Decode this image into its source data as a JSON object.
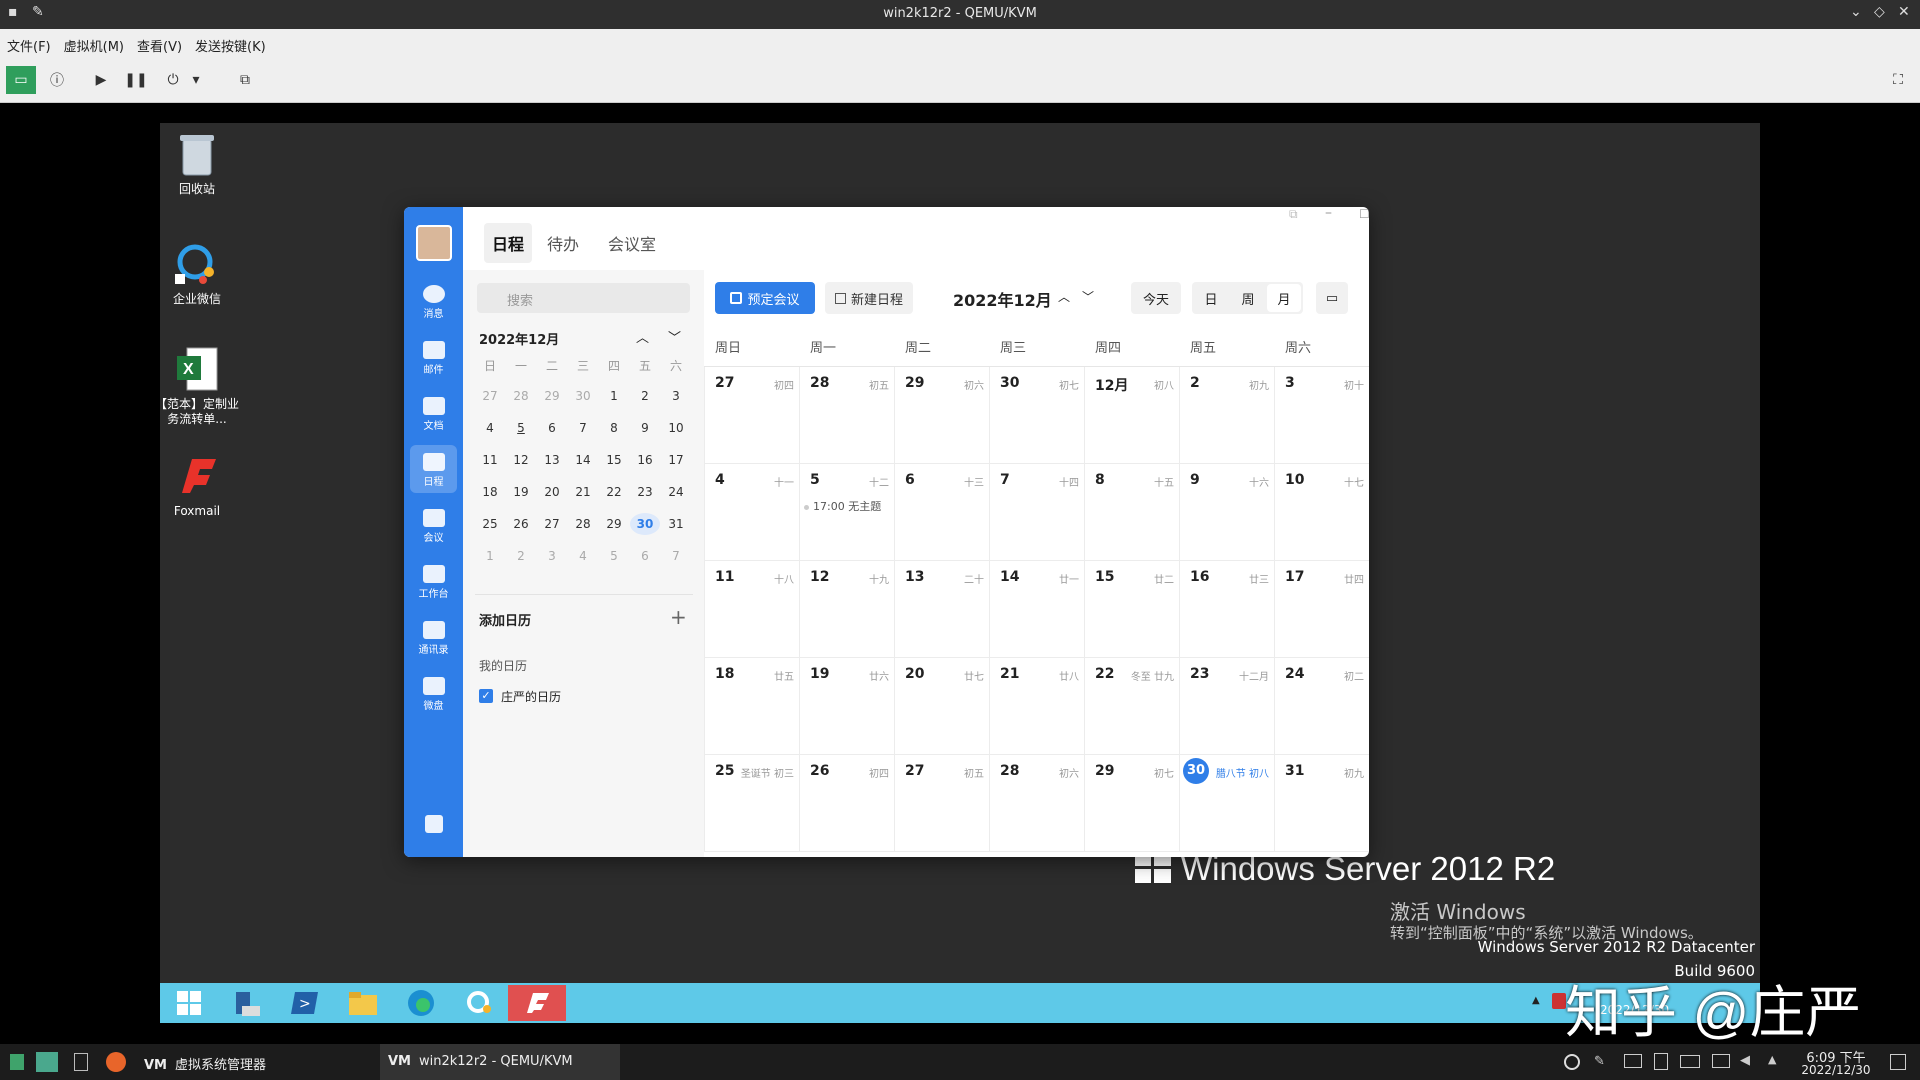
{
  "host_window": {
    "title": "win2k12r2 - QEMU/KVM",
    "menu": [
      "文件(F)",
      "虚拟机(M)",
      "查看(V)",
      "发送按键(K)"
    ]
  },
  "desktop": {
    "icons": [
      {
        "label": "回收站",
        "icon": "recycle-bin-icon"
      },
      {
        "label": "企业微信",
        "icon": "wecom-icon"
      },
      {
        "label": "【范本】定制业务流转单...",
        "icon": "excel-file-icon"
      },
      {
        "label": "Foxmail",
        "icon": "foxmail-icon"
      }
    ],
    "watermark": "Windows Server 2012 R2",
    "activate_title": "激活 Windows",
    "activate_hint": "转到“控制面板”中的“系统”以激活 Windows。",
    "edition": "Windows Server 2012 R2 Datacenter",
    "build": "Build 9600",
    "tray_date": "2022/12/30",
    "overlay": "知乎 @庄严"
  },
  "app": {
    "rail_items": [
      {
        "label": "消息",
        "icon": "message-icon"
      },
      {
        "label": "邮件",
        "icon": "mail-icon"
      },
      {
        "label": "文档",
        "icon": "document-icon"
      },
      {
        "label": "日程",
        "icon": "calendar-icon"
      },
      {
        "label": "会议",
        "icon": "meeting-icon"
      },
      {
        "label": "工作台",
        "icon": "workbench-icon"
      },
      {
        "label": "通讯录",
        "icon": "contacts-icon"
      },
      {
        "label": "微盘",
        "icon": "drive-icon"
      }
    ],
    "tabs": [
      "日程",
      "待办",
      "会议室"
    ],
    "search_placeholder": "搜索",
    "mini_title": "2022年12月",
    "mini_weekdays": [
      "日",
      "一",
      "二",
      "三",
      "四",
      "五",
      "六"
    ],
    "mini_days": [
      "27",
      "28",
      "29",
      "30",
      "1",
      "2",
      "3",
      "4",
      "5",
      "6",
      "7",
      "8",
      "9",
      "10",
      "11",
      "12",
      "13",
      "14",
      "15",
      "16",
      "17",
      "18",
      "19",
      "20",
      "21",
      "22",
      "23",
      "24",
      "25",
      "26",
      "27",
      "28",
      "29",
      "30",
      "31",
      "1",
      "2",
      "3",
      "4",
      "5",
      "6",
      "7"
    ],
    "add_calendar": "添加日历",
    "my_calendars": "我的日历",
    "calendar_name": "庄严的日历",
    "btn_book": "预定会议",
    "btn_new": "新建日程",
    "month_title": "2022年12月",
    "btn_today": "今天",
    "views": [
      "日",
      "周",
      "月"
    ],
    "week_headers": [
      "周日",
      "周一",
      "周二",
      "周三",
      "周四",
      "周五",
      "周六"
    ],
    "cells": [
      {
        "d": "27",
        "l": "初四"
      },
      {
        "d": "28",
        "l": "初五"
      },
      {
        "d": "29",
        "l": "初六"
      },
      {
        "d": "30",
        "l": "初七"
      },
      {
        "d": "12月",
        "l": "初八"
      },
      {
        "d": "2",
        "l": "初九"
      },
      {
        "d": "3",
        "l": "初十"
      },
      {
        "d": "4",
        "l": "十一"
      },
      {
        "d": "5",
        "l": "十二",
        "e": "17:00 无主题"
      },
      {
        "d": "6",
        "l": "十三"
      },
      {
        "d": "7",
        "l": "十四"
      },
      {
        "d": "8",
        "l": "十五"
      },
      {
        "d": "9",
        "l": "十六"
      },
      {
        "d": "10",
        "l": "十七"
      },
      {
        "d": "11",
        "l": "十八"
      },
      {
        "d": "12",
        "l": "十九"
      },
      {
        "d": "13",
        "l": "二十"
      },
      {
        "d": "14",
        "l": "廿一"
      },
      {
        "d": "15",
        "l": "廿二"
      },
      {
        "d": "16",
        "l": "廿三"
      },
      {
        "d": "17",
        "l": "廿四"
      },
      {
        "d": "18",
        "l": "廿五"
      },
      {
        "d": "19",
        "l": "廿六"
      },
      {
        "d": "20",
        "l": "廿七"
      },
      {
        "d": "21",
        "l": "廿八"
      },
      {
        "d": "22",
        "l": "冬至  廿九"
      },
      {
        "d": "23",
        "l": "十二月"
      },
      {
        "d": "24",
        "l": "初二"
      },
      {
        "d": "25",
        "l": "圣诞节 初三"
      },
      {
        "d": "26",
        "l": "初四"
      },
      {
        "d": "27",
        "l": "初五"
      },
      {
        "d": "28",
        "l": "初六"
      },
      {
        "d": "29",
        "l": "初七"
      },
      {
        "d": "30",
        "l": "腊八节 初八",
        "today": true
      },
      {
        "d": "31",
        "l": "初九"
      }
    ]
  },
  "host_taskbar": {
    "apps": [
      "虚拟系统管理器",
      "win2k12r2 - QEMU/KVM"
    ],
    "time": "6:09 下午",
    "date": "2022/12/30"
  },
  "colors": {
    "accent": "#2f7ee8",
    "taskbar": "#5ec9e8"
  }
}
